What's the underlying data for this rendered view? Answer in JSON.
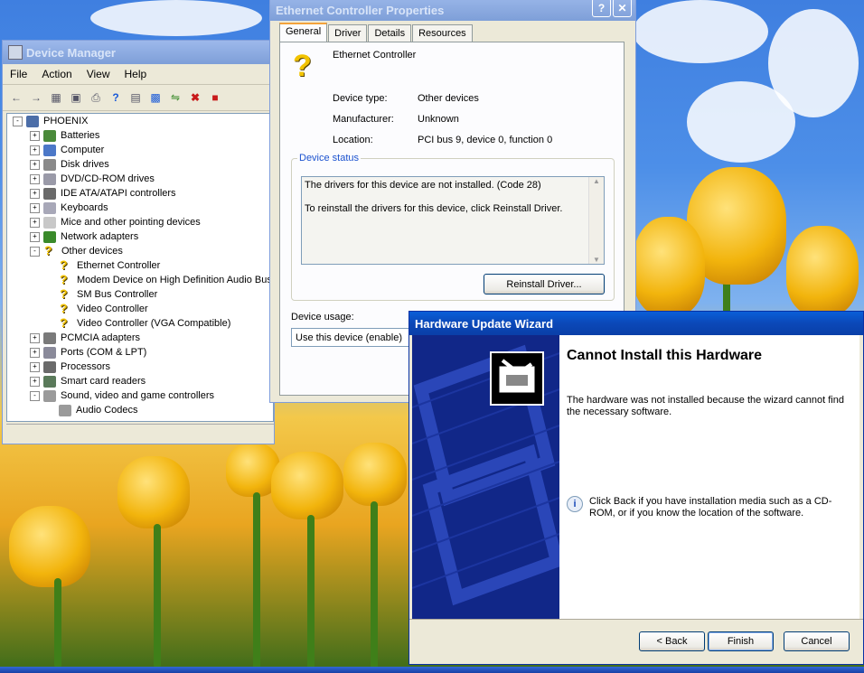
{
  "device_manager": {
    "title": "Device Manager",
    "menu": [
      "File",
      "Action",
      "View",
      "Help"
    ],
    "toolbar_icons": [
      "back-icon",
      "forward-icon",
      "show-hide-tree-icon",
      "properties-icon",
      "print-icon",
      "help-icon",
      "view-icon",
      "computer-icon",
      "scan-hardware-icon",
      "uninstall-icon",
      "disable-icon"
    ],
    "tree": [
      {
        "label": "PHOENIX",
        "level": 0,
        "expander": "-",
        "icon": "computer-icon",
        "color": "#4c6ea8"
      },
      {
        "label": "Batteries",
        "level": 1,
        "expander": "+",
        "icon": "battery-icon",
        "color": "#4a8a3a"
      },
      {
        "label": "Computer",
        "level": 1,
        "expander": "+",
        "icon": "computer-icon",
        "color": "#4c78c8"
      },
      {
        "label": "Disk drives",
        "level": 1,
        "expander": "+",
        "icon": "disk-drive-icon",
        "color": "#8a8a8a"
      },
      {
        "label": "DVD/CD-ROM drives",
        "level": 1,
        "expander": "+",
        "icon": "cd-drive-icon",
        "color": "#9a9aa8"
      },
      {
        "label": "IDE ATA/ATAPI controllers",
        "level": 1,
        "expander": "+",
        "icon": "ide-controller-icon",
        "color": "#6a6a6a"
      },
      {
        "label": "Keyboards",
        "level": 1,
        "expander": "+",
        "icon": "keyboard-icon",
        "color": "#a8a8b8"
      },
      {
        "label": "Mice and other pointing devices",
        "level": 1,
        "expander": "+",
        "icon": "mouse-icon",
        "color": "#c8c8c8"
      },
      {
        "label": "Network adapters",
        "level": 1,
        "expander": "+",
        "icon": "network-adapter-icon",
        "color": "#3a8a2a"
      },
      {
        "label": "Other devices",
        "level": 1,
        "expander": "-",
        "icon": "warning-icon",
        "color": "#f2c300"
      },
      {
        "label": "Ethernet Controller",
        "level": 2,
        "expander": "",
        "icon": "warning-icon",
        "color": "#f2c300"
      },
      {
        "label": "Modem Device on High Definition Audio Bus",
        "level": 2,
        "expander": "",
        "icon": "warning-icon",
        "color": "#f2c300"
      },
      {
        "label": "SM Bus Controller",
        "level": 2,
        "expander": "",
        "icon": "warning-icon",
        "color": "#f2c300"
      },
      {
        "label": "Video Controller",
        "level": 2,
        "expander": "",
        "icon": "warning-icon",
        "color": "#f2c300"
      },
      {
        "label": "Video Controller (VGA Compatible)",
        "level": 2,
        "expander": "",
        "icon": "warning-icon",
        "color": "#f2c300"
      },
      {
        "label": "PCMCIA adapters",
        "level": 1,
        "expander": "+",
        "icon": "pcmcia-icon",
        "color": "#7a7a7a"
      },
      {
        "label": "Ports (COM & LPT)",
        "level": 1,
        "expander": "+",
        "icon": "port-icon",
        "color": "#8a8a9a"
      },
      {
        "label": "Processors",
        "level": 1,
        "expander": "+",
        "icon": "processor-icon",
        "color": "#6a6a6a"
      },
      {
        "label": "Smart card readers",
        "level": 1,
        "expander": "+",
        "icon": "smart-card-icon",
        "color": "#5a7a5a"
      },
      {
        "label": "Sound, video and game controllers",
        "level": 1,
        "expander": "-",
        "icon": "sound-icon",
        "color": "#9a9a9a"
      },
      {
        "label": "Audio Codecs",
        "level": 2,
        "expander": "",
        "icon": "audio-codec-icon",
        "color": "#9a9a9a"
      }
    ]
  },
  "properties": {
    "title": "Ethernet Controller Properties",
    "tabs": [
      "General",
      "Driver",
      "Details",
      "Resources"
    ],
    "device_name": "Ethernet Controller",
    "device_type_label": "Device type:",
    "device_type": "Other devices",
    "manufacturer_label": "Manufacturer:",
    "manufacturer": "Unknown",
    "location_label": "Location:",
    "location": "PCI bus 9, device 0, function 0",
    "status_legend": "Device status",
    "status_line1": "The drivers for this device are not installed. (Code 28)",
    "status_line2": "To reinstall the drivers for this device, click Reinstall Driver.",
    "reinstall_button": "Reinstall Driver...",
    "usage_label": "Device usage:",
    "usage_value": "Use this device (enable)"
  },
  "wizard": {
    "title": "Hardware Update Wizard",
    "heading": "Cannot Install this Hardware",
    "message": "The hardware was not installed because the wizard cannot find the necessary software.",
    "hint": "Click Back if you have installation media such as a CD-ROM, or if you know the location of the software.",
    "back_button": "< Back",
    "finish_button": "Finish",
    "cancel_button": "Cancel"
  }
}
